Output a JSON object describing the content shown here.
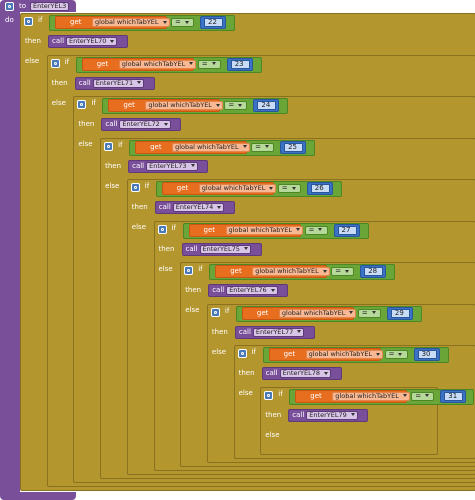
{
  "procedure": {
    "to_label": "to",
    "do_label": "do",
    "name": "EnterYEL3"
  },
  "keywords": {
    "if": "if",
    "then": "then",
    "else": "else",
    "get": "get",
    "call": "call",
    "eq": "="
  },
  "variable": "global whichTabYEL",
  "blocks": [
    {
      "compare": "22",
      "call": "EnterYEL70"
    },
    {
      "compare": "23",
      "call": "EnterYEL71"
    },
    {
      "compare": "24",
      "call": "EnterYEL72"
    },
    {
      "compare": "25",
      "call": "EnterYEL73"
    },
    {
      "compare": "26",
      "call": "EnterYEL74"
    },
    {
      "compare": "27",
      "call": "EnterYEL75"
    },
    {
      "compare": "28",
      "call": "EnterYEL76"
    },
    {
      "compare": "29",
      "call": "EnterYEL77"
    },
    {
      "compare": "30",
      "call": "EnterYEL78"
    },
    {
      "compare": "31",
      "call": "EnterYEL79"
    }
  ]
}
